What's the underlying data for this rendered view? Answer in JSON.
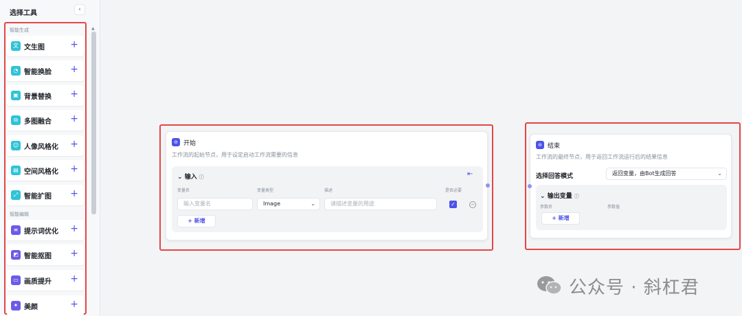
{
  "sidebar": {
    "title": "选择工具",
    "collapse_glyph": "‹",
    "groups": [
      {
        "label": "智能生成"
      },
      {
        "label": "智能编辑"
      }
    ],
    "items": [
      {
        "label": "文生图",
        "icon": "text-to-image-icon",
        "color": "#2fc3d6",
        "glyph": "文"
      },
      {
        "label": "智能换脸",
        "icon": "face-swap-icon",
        "color": "#2fc3d6",
        "glyph": "◔"
      },
      {
        "label": "背景替换",
        "icon": "background-replace-icon",
        "color": "#2fc3d6",
        "glyph": "▣"
      },
      {
        "label": "多图融合",
        "icon": "multi-image-fusion-icon",
        "color": "#2fc3d6",
        "glyph": "⧉"
      },
      {
        "label": "人像风格化",
        "icon": "portrait-style-icon",
        "color": "#2fc3d6",
        "glyph": "☺"
      },
      {
        "label": "空间风格化",
        "icon": "space-style-icon",
        "color": "#2fc3d6",
        "glyph": "▤"
      },
      {
        "label": "智能扩图",
        "icon": "image-expand-icon",
        "color": "#2fc3d6",
        "glyph": "⤢"
      },
      {
        "label": "提示词优化",
        "icon": "prompt-optimize-icon",
        "color": "#6b5be8",
        "glyph": "≡"
      },
      {
        "label": "智能抠图",
        "icon": "smart-cutout-icon",
        "color": "#6b5be8",
        "glyph": "◩"
      },
      {
        "label": "画质提升",
        "icon": "quality-enhance-icon",
        "color": "#6b5be8",
        "glyph": "▭"
      },
      {
        "label": "美颜",
        "icon": "beauty-icon",
        "color": "#6b5be8",
        "glyph": "✦"
      }
    ],
    "plus_glyph": "+"
  },
  "start_node": {
    "title": "开始",
    "icon": "start-node-icon",
    "description": "工作流的起始节点，用于设定启动工作流需要的信息",
    "input_section": "输入",
    "info_glyph": "ⓘ",
    "columns": [
      "变量名",
      "变量类型",
      "描述",
      "是否必要"
    ],
    "row": {
      "name_placeholder": "输入变量名",
      "type_value": "Image",
      "desc_placeholder": "请描述变量的用途",
      "required": true
    },
    "add_label": "+ 新增"
  },
  "end_node": {
    "title": "结束",
    "icon": "end-node-icon",
    "description": "工作流的最终节点，用于返回工作流运行后的结果信息",
    "answer_mode_label": "选择回答模式",
    "answer_mode_value": "返回变量，由Bot生成回答",
    "output_section": "输出变量",
    "columns": [
      "参数名",
      "参数值"
    ],
    "add_label": "+ 新增"
  },
  "watermark": {
    "text": "公众号 · 斜杠君",
    "icon": "wechat-logo-icon"
  },
  "colors": {
    "accent": "#4d53e8",
    "highlight_frame": "#e24646",
    "generate_icon": "#2fc3d6",
    "edit_icon": "#6b5be8"
  }
}
